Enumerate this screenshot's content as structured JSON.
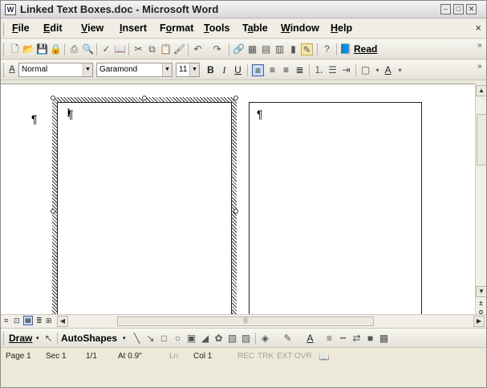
{
  "window": {
    "title": "Linked Text Boxes.doc - Microsoft Word",
    "app_icon": "W",
    "controls": [
      "–",
      "□",
      "✕"
    ]
  },
  "menu": [
    {
      "label": "File",
      "u": "F",
      "rest": "ile"
    },
    {
      "label": "Edit",
      "u": "E",
      "rest": "dit"
    },
    {
      "label": "View",
      "u": "V",
      "rest": "iew"
    },
    {
      "label": "Insert",
      "u": "I",
      "rest": "nsert"
    },
    {
      "label": "Format",
      "pre": "F",
      "u": "o",
      "rest": "rmat"
    },
    {
      "label": "Tools",
      "u": "T",
      "rest": "ools"
    },
    {
      "label": "Table",
      "pre": "T",
      "u": "a",
      "rest": "ble"
    },
    {
      "label": "Window",
      "u": "W",
      "rest": "indow"
    },
    {
      "label": "Help",
      "u": "H",
      "rest": "elp"
    }
  ],
  "doc_close": "×",
  "standard_toolbar": {
    "icons": [
      "new-icon",
      "open-icon",
      "save-icon",
      "permission-icon",
      "print-icon",
      "print-preview-icon",
      "spelling-icon",
      "research-icon",
      "cut-icon",
      "copy-icon",
      "paste-icon",
      "format-painter-icon",
      "undo-icon",
      "redo-icon",
      "hyperlink-icon",
      "tables-borders-icon",
      "insert-table-icon",
      "insert-excel-icon",
      "columns-icon",
      "drawing-icon",
      "help-icon"
    ],
    "read_label": "Read"
  },
  "formatting_toolbar": {
    "style": "Normal",
    "style_icon": "A",
    "font": "Garamond",
    "size": "11",
    "bold": "B",
    "italic": "I",
    "underline": "U"
  },
  "document": {
    "pilcrow": "¶",
    "cursor": "I"
  },
  "hscroll": {
    "thumb_grip": "|||"
  },
  "draw_toolbar": {
    "draw_label": "Draw",
    "autoshapes_label": "AutoShapes"
  },
  "status": {
    "page": "Page 1",
    "sec": "Sec 1",
    "pages": "1/1",
    "at": "At 0.9\"",
    "ln": "Ln",
    "col": "Col 1",
    "rec": "REC",
    "trk": "TRK",
    "ext": "EXT",
    "ovr": "OVR"
  }
}
